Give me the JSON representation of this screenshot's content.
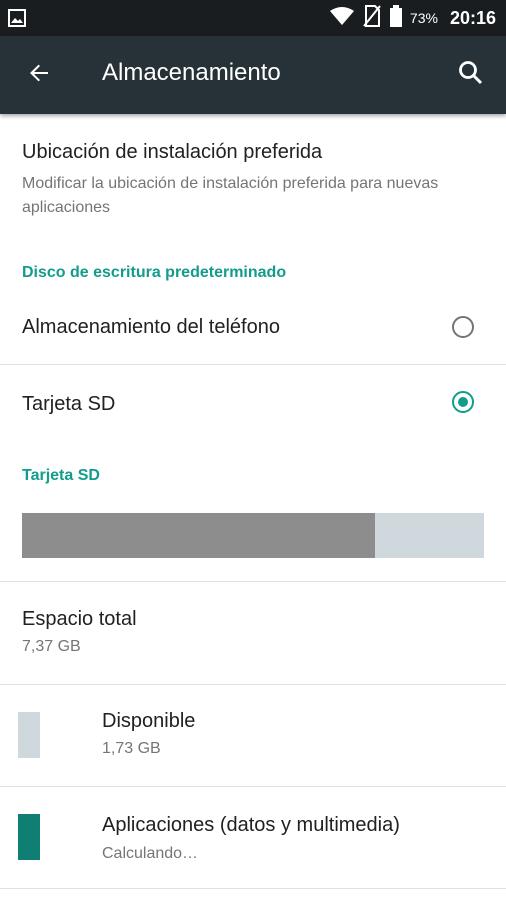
{
  "status_bar": {
    "battery_percent": "73%",
    "time": "20:16"
  },
  "app_bar": {
    "title": "Almacenamiento",
    "back_icon": "arrow-back-icon",
    "search_icon": "search-icon"
  },
  "install_location": {
    "title": "Ubicación de instalación preferida",
    "subtitle": "Modificar la ubicación de instalación preferida para nuevas aplicaciones"
  },
  "default_disk": {
    "header": "Disco de escritura predeterminado",
    "options": [
      {
        "label": "Almacenamiento del teléfono",
        "selected": false
      },
      {
        "label": "Tarjeta SD",
        "selected": true
      }
    ]
  },
  "sd_card": {
    "header": "Tarjeta SD",
    "used_fraction": 0.765,
    "total_title": "Espacio total",
    "total_value": "7,37 GB",
    "items": [
      {
        "title": "Disponible",
        "value": "1,73 GB",
        "color": "#cfd8dc"
      },
      {
        "title": "Aplicaciones (datos y multimedia)",
        "value": "Calculando…",
        "color": "#0e7f72"
      }
    ]
  },
  "colors": {
    "accent": "#129c8c",
    "app_bar": "#263238",
    "status_bar": "#1a1d1f",
    "used_bar": "#8d8d8d",
    "free_bar": "#cfd8dc"
  }
}
